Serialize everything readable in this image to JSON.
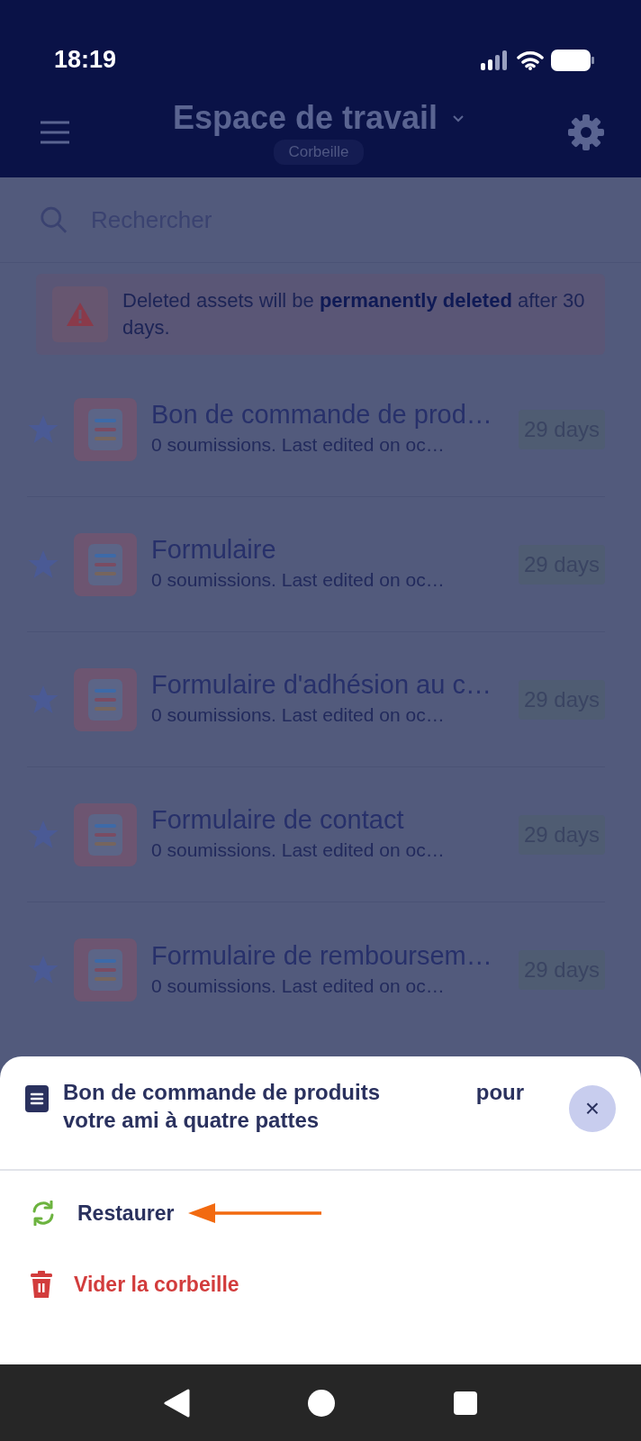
{
  "status_bar": {
    "time": "18:19"
  },
  "header": {
    "title": "Espace de travail",
    "subtitle": "Corbeille"
  },
  "search": {
    "placeholder": "Rechercher"
  },
  "banner": {
    "text": "Deleted assets will be **permanently deleted** after 30 days."
  },
  "items": [
    {
      "title": "Bon de commande de prod…",
      "subtitle": "0 soumissions. Last edited on oc…",
      "badge": "29 days"
    },
    {
      "title": "Formulaire",
      "subtitle": "0 soumissions. Last edited on oc…",
      "badge": "29 days"
    },
    {
      "title": "Formulaire d'adhésion au c…",
      "subtitle": "0 soumissions. Last edited on oc…",
      "badge": "29 days"
    },
    {
      "title": "Formulaire de contact",
      "subtitle": "0 soumissions. Last edited on oc…",
      "badge": "29 days"
    },
    {
      "title": "Formulaire de remboursem…",
      "subtitle": "0 soumissions. Last edited on oc…",
      "badge": "29 days"
    }
  ],
  "sheet": {
    "title": "Bon de commande de produits                pour votre ami à quatre pattes",
    "close": "×",
    "actions": [
      {
        "label": "Restaurer",
        "kind": "restore",
        "annotated": true
      },
      {
        "label": "Vider la corbeille",
        "kind": "delete",
        "annotated": false
      }
    ]
  }
}
